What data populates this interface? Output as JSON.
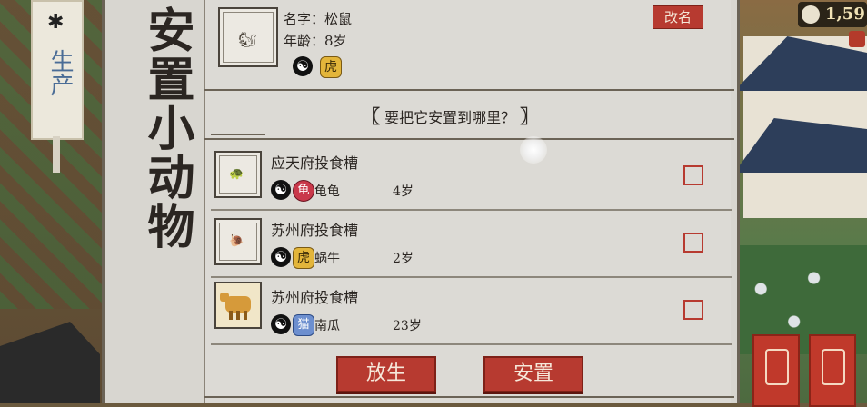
{
  "side_title": "安置小动物",
  "sign": {
    "top_glyph": "✱",
    "label": "生产"
  },
  "currency": {
    "value": "1,59"
  },
  "selected_animal": {
    "name_line": "名字：松鼠",
    "age_line": "年龄：8岁",
    "icon": "squirrel-icon",
    "rename_label": "改名"
  },
  "prompt": {
    "left_bracket": "〖",
    "text": "要把它安置到哪里？",
    "right_bracket": "〗"
  },
  "slots": [
    {
      "place": "应天府投食槽",
      "animal_name": "龟龟",
      "age": "4岁",
      "pet_icon": "turtle-icon",
      "zodiac_glyph": "龟"
    },
    {
      "place": "苏州府投食槽",
      "animal_name": "蜗牛",
      "age": "2岁",
      "pet_icon": "snail-icon",
      "zodiac_glyph": "虎"
    },
    {
      "place": "苏州府投食槽",
      "animal_name": "南瓜",
      "age": "23岁",
      "pet_icon": "cow-icon",
      "zodiac_glyph": "猫"
    }
  ],
  "buttons": {
    "release": "放生",
    "settle": "安置"
  },
  "colors": {
    "accent_red": "#b73a30",
    "panel_bg": "#dcdad5",
    "ink": "#2b2622"
  }
}
